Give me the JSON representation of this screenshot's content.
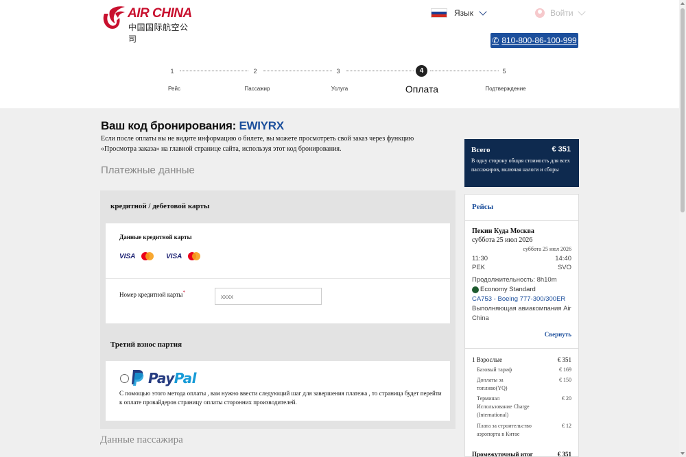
{
  "brand": {
    "logo_en": "AIR CHINA",
    "logo_cn": "中国国际航空公司",
    "color": "#c8102e"
  },
  "header": {
    "language": "Язык",
    "login": "Войти",
    "phone": "810-800-86-100-999",
    "phone_icon": "phone-icon"
  },
  "steps": [
    {
      "num": "1",
      "label": "Рейс"
    },
    {
      "num": "2",
      "label": "Пассажир"
    },
    {
      "num": "3",
      "label": "Услуга"
    },
    {
      "num": "4",
      "label": "Оплата",
      "active": true
    },
    {
      "num": "5",
      "label": "Подтверждение"
    }
  ],
  "booking": {
    "title": "Ваш код бронирования:",
    "code": "EWIYRX",
    "note": "Если после оплаты вы не видите информацию о билете, вы можете просмотреть свой заказ через функцию «Просмотра заказа» на главной странице сайта, используя этот код бронирования."
  },
  "payment": {
    "section_title": "Платежные данные",
    "card_method_title": "кредитной / дебетовой карты",
    "card_data_label": "Данные кредитной карты",
    "card_logos": [
      "VISA",
      "mastercard",
      "VISA",
      "mastercard"
    ],
    "card_number_label": "Номер кредитной карты",
    "card_number_required": "*",
    "card_number_placeholder": "xxxx",
    "third_party_title": "Третий взнос партия",
    "paypal_pay": "Pay",
    "paypal_pal": "Pal",
    "paypal_note": "С помощью этого метода оплаты , вам нужно ввести следующий шаг для завершения платежа , то страница будет перейти к оплате провайдеров страницу оплаты сторонних производителей."
  },
  "passenger_title": "Данные пассажира",
  "summary": {
    "total_label": "Всего",
    "total_value": "€ 351",
    "total_desc": "В одну сторону общая стоимость для всех пассажиров, включая налоги и сборы",
    "flights_title": "Рейсы",
    "route": "Пекин Куда Москва",
    "date": "суббота 25 июл 2026",
    "date_small": "суббота 25 июл 2026",
    "dep_time": "11:30",
    "arr_time": "14:40",
    "dep_code": "PEK",
    "arr_code": "SVO",
    "duration": "Продолжительность: 8h10m",
    "cabin": "Economy Standard",
    "flight_no": "CA753 - Boeing 777-300/300ER",
    "operator": "Выполняющая авиакомпания Air China",
    "collapse": "Свернуть",
    "adults_label": "1 Взрослые",
    "adults_value": "€ 351",
    "fees": [
      {
        "name": "Базовый тариф",
        "value": "€ 169"
      },
      {
        "name": "Доплаты за топливо(YQ)",
        "value": "€ 150"
      },
      {
        "name": "Терминал Использование Charge (International)",
        "value": "€ 20"
      },
      {
        "name": "Плата за строительство аэропорта в Китае",
        "value": "€ 12"
      }
    ],
    "subtotal_label": "Промежуточный итог",
    "subtotal_value": "€ 351"
  }
}
